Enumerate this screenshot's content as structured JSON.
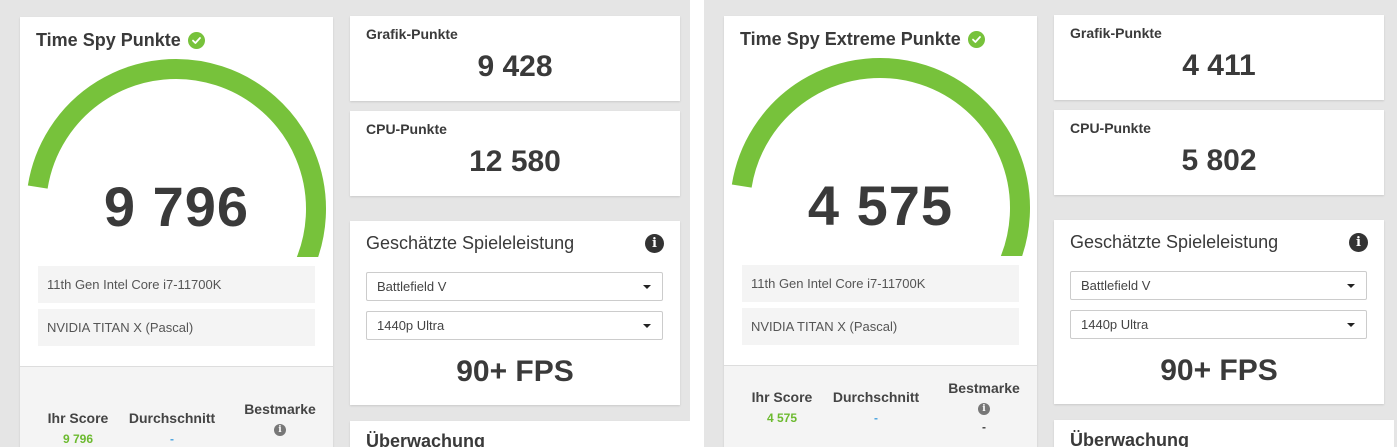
{
  "panels": [
    {
      "title": "Time Spy Punkte",
      "score": "9 796",
      "score_fraction": 0.999,
      "cpu_name": "11th Gen Intel Core i7-11700K",
      "gpu_name": "NVIDIA TITAN X (Pascal)",
      "graphics_label": "Grafik-Punkte",
      "graphics_score": "9 428",
      "cpu_label": "CPU-Punkte",
      "cpu_score": "12 580",
      "estimate_title": "Geschätzte Spieleleistung",
      "game_select": "Battlefield V",
      "resolution_select": "1440p Ultra",
      "fps": "90+ FPS",
      "your_score_label": "Ihr Score",
      "your_score": "9 796",
      "average_label": "Durchschnitt",
      "average_value": "-",
      "best_label": "Bestmarke",
      "best_value": "-",
      "monitoring_title": "Überwachung"
    },
    {
      "title": "Time Spy Extreme Punkte",
      "score": "4 575",
      "score_fraction": 0.999,
      "cpu_name": "11th Gen Intel Core i7-11700K",
      "gpu_name": "NVIDIA TITAN X (Pascal)",
      "graphics_label": "Grafik-Punkte",
      "graphics_score": "4 411",
      "cpu_label": "CPU-Punkte",
      "cpu_score": "5 802",
      "estimate_title": "Geschätzte Spieleleistung",
      "game_select": "Battlefield V",
      "resolution_select": "1440p Ultra",
      "fps": "90+ FPS",
      "your_score_label": "Ihr Score",
      "your_score": "4 575",
      "average_label": "Durchschnitt",
      "average_value": "-",
      "best_label": "Bestmarke",
      "best_value": "-",
      "monitoring_title": "Überwachung"
    }
  ],
  "colors": {
    "gauge_green": "#77c23b",
    "your_score_green": "#6cba2f",
    "average_blue": "#4aa3df",
    "knob_gray": "#9e9e9e"
  },
  "icons": {
    "verified": "check-circle-icon",
    "info": "info-icon",
    "dropdown": "caret-down-icon"
  }
}
